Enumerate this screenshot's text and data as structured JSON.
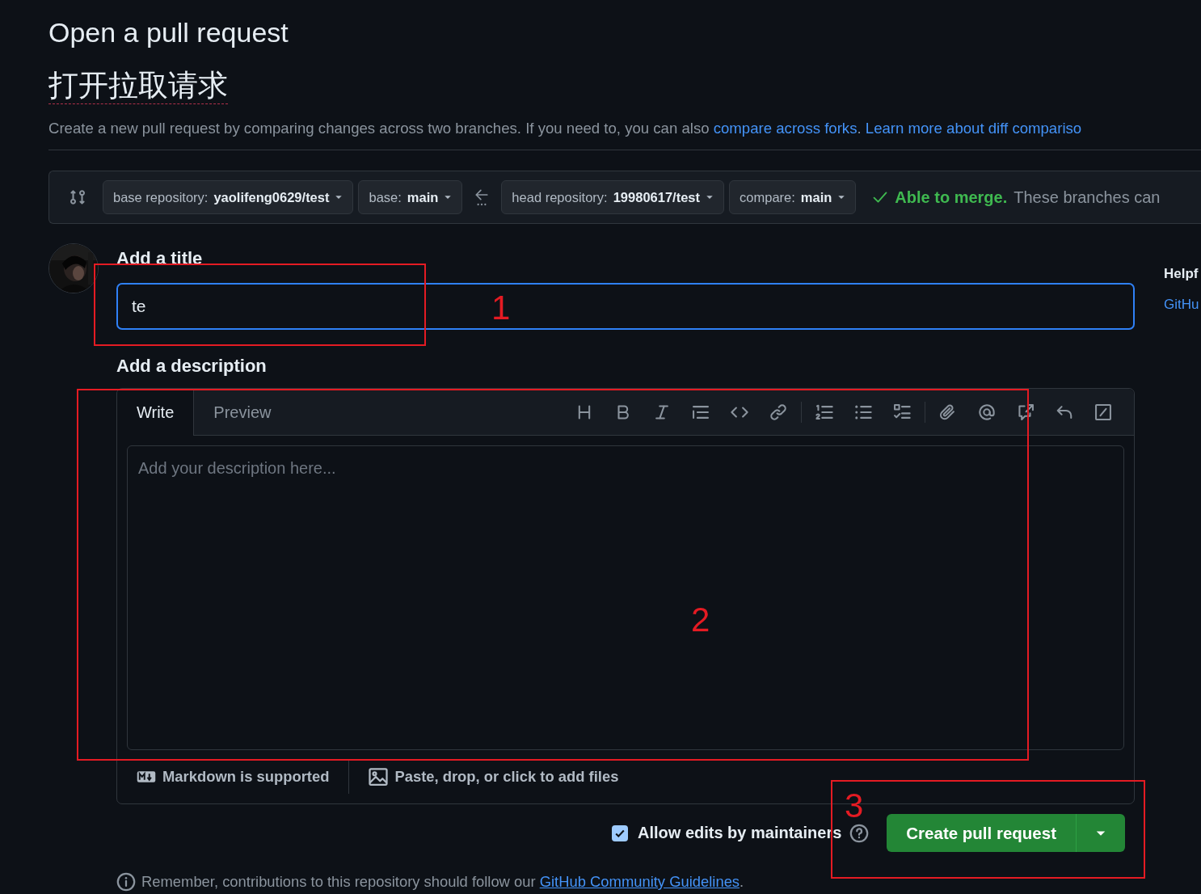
{
  "heading": {
    "title": "Open a pull request",
    "subtitle": "打开拉取请求"
  },
  "intro": [
    {
      "kind": "text",
      "text": "Create a new pull request by comparing changes across two branches. If you need to, you can also "
    },
    {
      "kind": "link",
      "text": "compare across forks"
    },
    {
      "kind": "text",
      "text": ". "
    },
    {
      "kind": "link",
      "text": "Learn more about diff compariso"
    }
  ],
  "compare_bar": {
    "selectors": [
      {
        "label": "base repository:",
        "value": "yaolifeng0629/test"
      },
      {
        "label": "base:",
        "value": "main"
      },
      {
        "label": "head repository:",
        "value": "19980617/test"
      },
      {
        "label": "compare:",
        "value": "main"
      }
    ],
    "merge_status": "Able to merge.",
    "merge_detail": "These branches can"
  },
  "title_field": {
    "label": "Add a title",
    "value": "te"
  },
  "sidebar": {
    "heading": "Helpf",
    "link": "GitHu"
  },
  "description": {
    "label": "Add a description",
    "tabs": [
      {
        "label": "Write",
        "selected": true
      },
      {
        "label": "Preview",
        "selected": false
      }
    ],
    "placeholder": "Add your description here...",
    "footer": [
      "Markdown is supported",
      "Paste, drop, or click to add files"
    ]
  },
  "allow_edits": {
    "label": "Allow edits by maintainers",
    "checked": true
  },
  "submit": {
    "label": "Create pull request"
  },
  "notice": {
    "text": "Remember, contributions to this repository should follow our ",
    "link": "GitHub Community Guidelines",
    "end": "."
  },
  "annotations": [
    {
      "label": "1"
    },
    {
      "label": "2"
    },
    {
      "label": "3"
    }
  ]
}
